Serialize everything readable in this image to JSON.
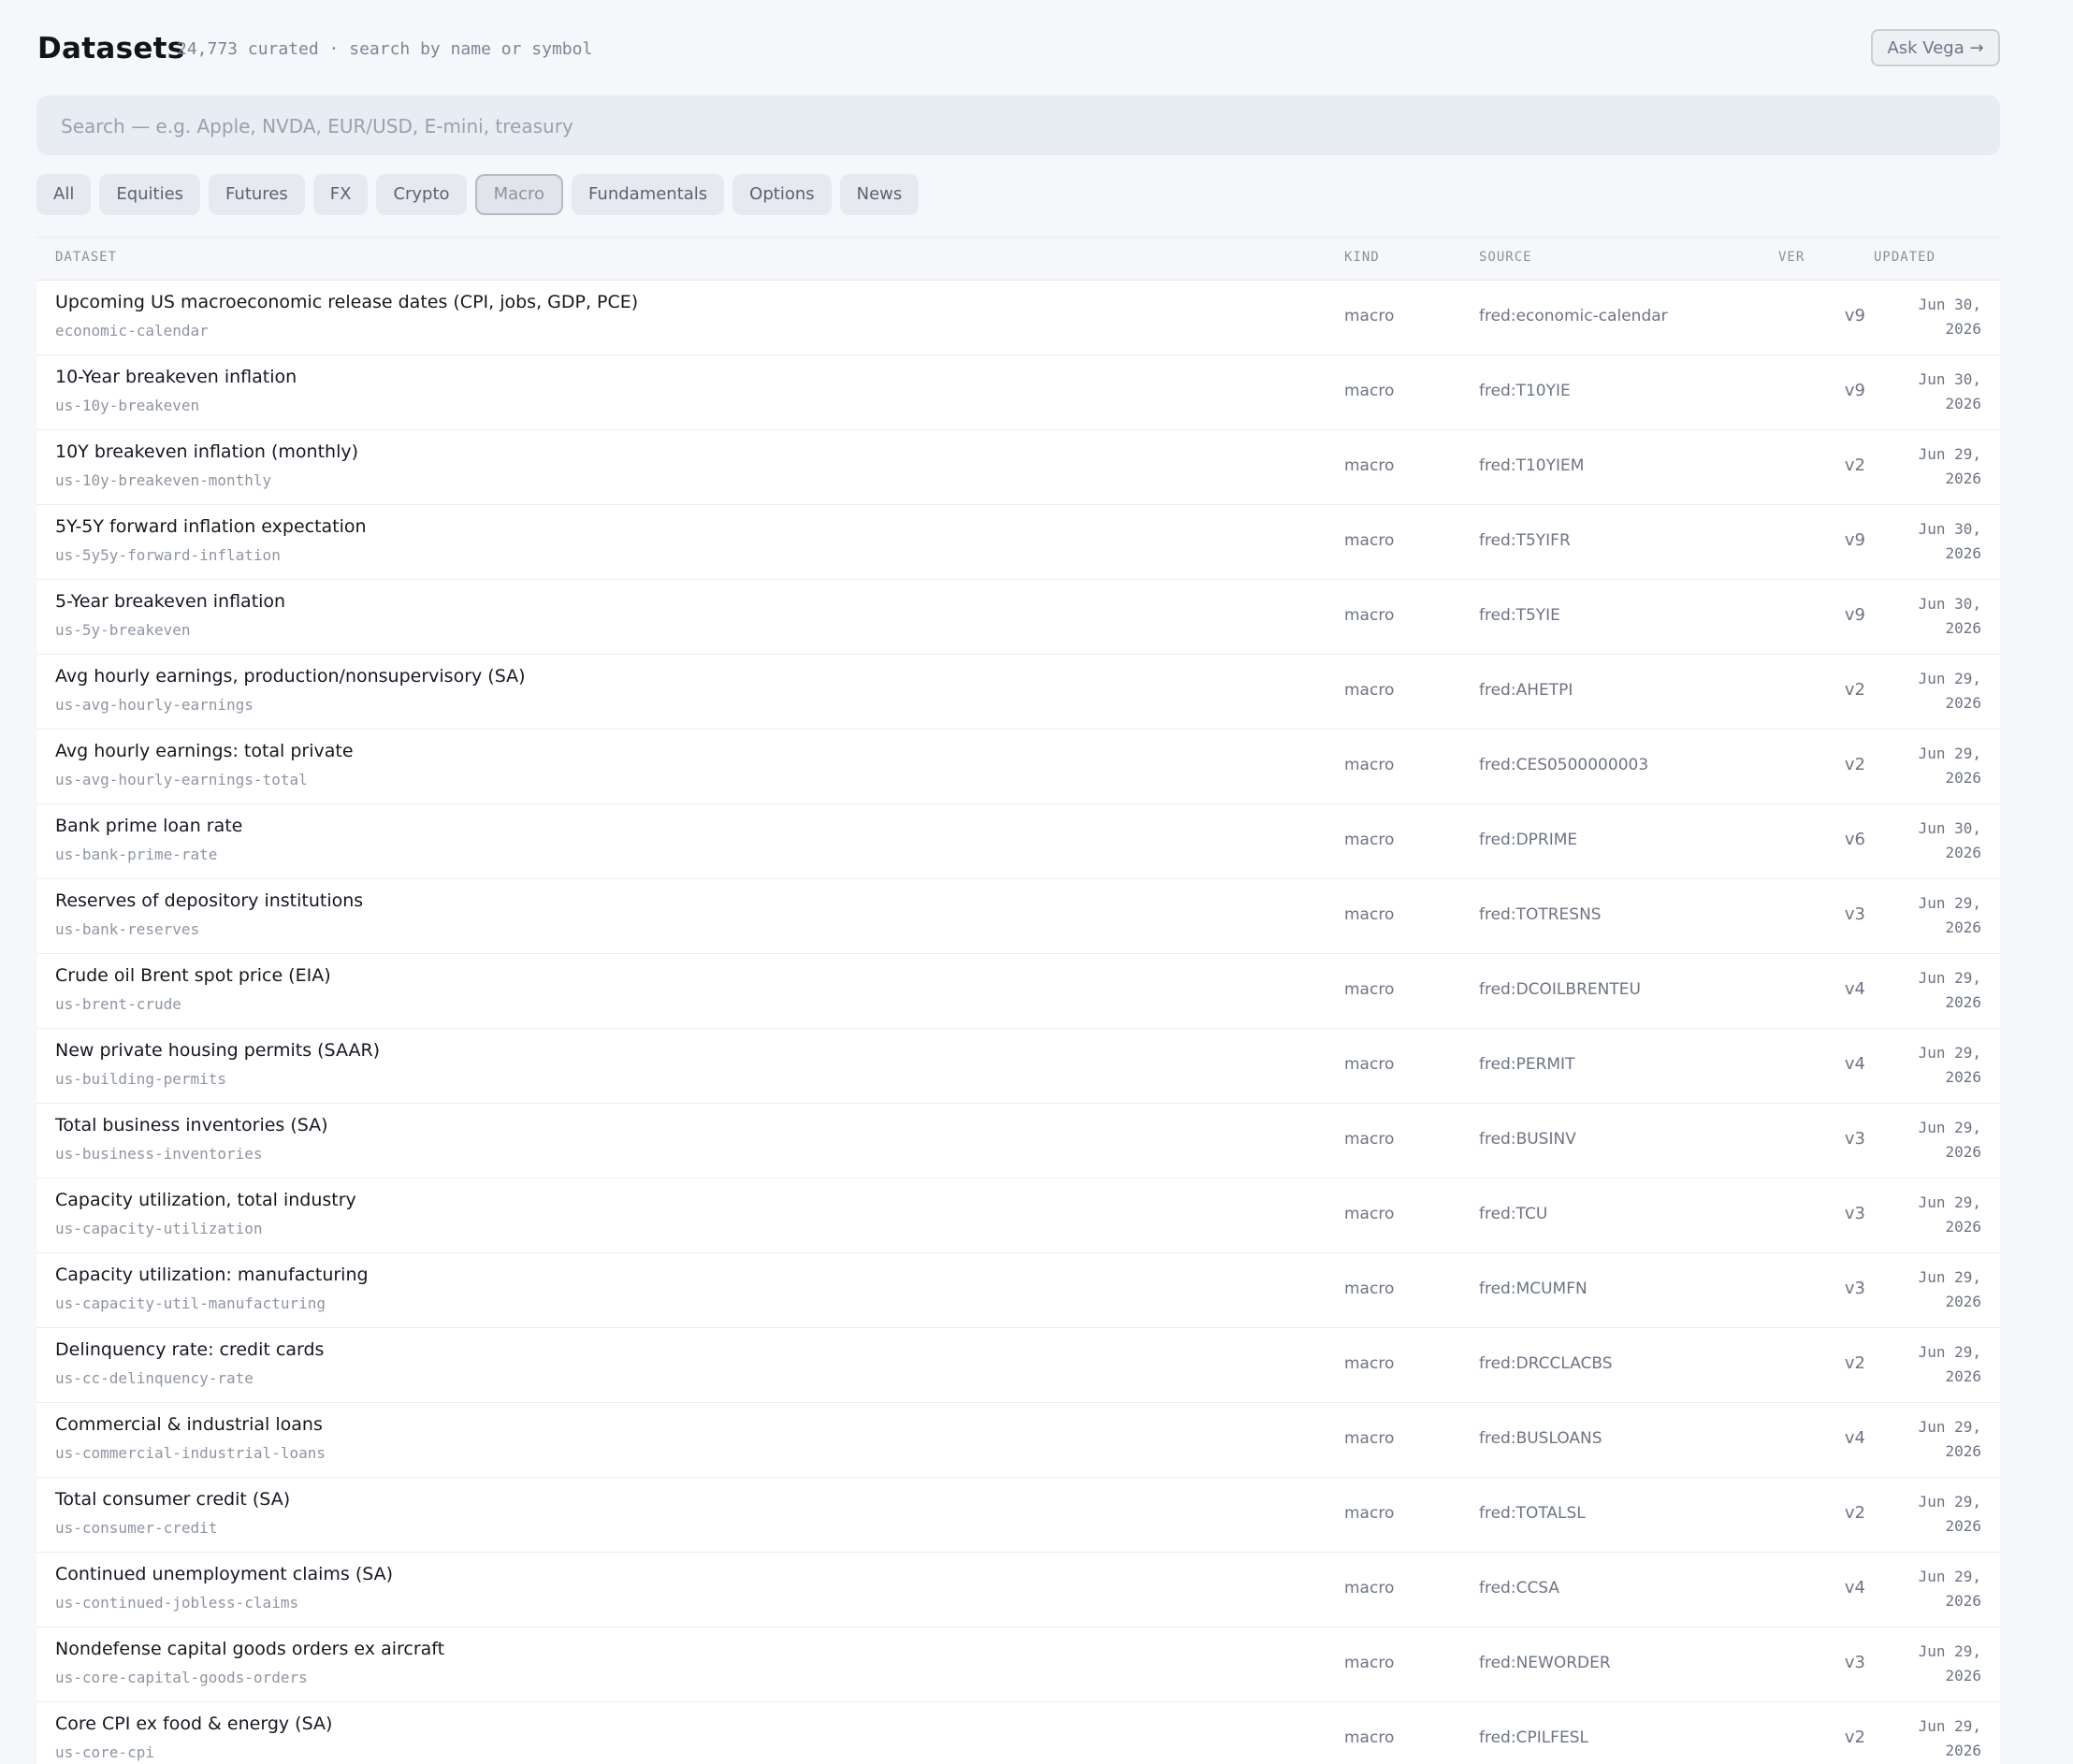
{
  "header": {
    "title": "Datasets",
    "subtitle": "24,773 curated · search by name or symbol",
    "ask_button": "Ask Vega →"
  },
  "search": {
    "placeholder": "Search — e.g. Apple, NVDA, EUR/USD, E-mini, treasury",
    "value": ""
  },
  "filters": [
    {
      "label": "All",
      "active": false
    },
    {
      "label": "Equities",
      "active": false
    },
    {
      "label": "Futures",
      "active": false
    },
    {
      "label": "FX",
      "active": false
    },
    {
      "label": "Crypto",
      "active": false
    },
    {
      "label": "Macro",
      "active": true
    },
    {
      "label": "Fundamentals",
      "active": false
    },
    {
      "label": "Options",
      "active": false
    },
    {
      "label": "News",
      "active": false
    }
  ],
  "table": {
    "columns": {
      "dataset": "DATASET",
      "kind": "KIND",
      "source": "SOURCE",
      "ver": "VER",
      "updated": "UPDATED"
    },
    "rows": [
      {
        "name": "Upcoming US macroeconomic release dates (CPI, jobs, GDP, PCE)",
        "slug": "economic-calendar",
        "kind": "macro",
        "source": "fred:economic-calendar",
        "ver": "v9",
        "updated_date": "Jun 30,",
        "updated_year": "2026"
      },
      {
        "name": "10-Year breakeven inflation",
        "slug": "us-10y-breakeven",
        "kind": "macro",
        "source": "fred:T10YIE",
        "ver": "v9",
        "updated_date": "Jun 30,",
        "updated_year": "2026"
      },
      {
        "name": "10Y breakeven inflation (monthly)",
        "slug": "us-10y-breakeven-monthly",
        "kind": "macro",
        "source": "fred:T10YIEM",
        "ver": "v2",
        "updated_date": "Jun 29,",
        "updated_year": "2026"
      },
      {
        "name": "5Y-5Y forward inflation expectation",
        "slug": "us-5y5y-forward-inflation",
        "kind": "macro",
        "source": "fred:T5YIFR",
        "ver": "v9",
        "updated_date": "Jun 30,",
        "updated_year": "2026"
      },
      {
        "name": "5-Year breakeven inflation",
        "slug": "us-5y-breakeven",
        "kind": "macro",
        "source": "fred:T5YIE",
        "ver": "v9",
        "updated_date": "Jun 30,",
        "updated_year": "2026"
      },
      {
        "name": "Avg hourly earnings, production/nonsupervisory (SA)",
        "slug": "us-avg-hourly-earnings",
        "kind": "macro",
        "source": "fred:AHETPI",
        "ver": "v2",
        "updated_date": "Jun 29,",
        "updated_year": "2026"
      },
      {
        "name": "Avg hourly earnings: total private",
        "slug": "us-avg-hourly-earnings-total",
        "kind": "macro",
        "source": "fred:CES0500000003",
        "ver": "v2",
        "updated_date": "Jun 29,",
        "updated_year": "2026"
      },
      {
        "name": "Bank prime loan rate",
        "slug": "us-bank-prime-rate",
        "kind": "macro",
        "source": "fred:DPRIME",
        "ver": "v6",
        "updated_date": "Jun 30,",
        "updated_year": "2026"
      },
      {
        "name": "Reserves of depository institutions",
        "slug": "us-bank-reserves",
        "kind": "macro",
        "source": "fred:TOTRESNS",
        "ver": "v3",
        "updated_date": "Jun 29,",
        "updated_year": "2026"
      },
      {
        "name": "Crude oil Brent spot price (EIA)",
        "slug": "us-brent-crude",
        "kind": "macro",
        "source": "fred:DCOILBRENTEU",
        "ver": "v4",
        "updated_date": "Jun 29,",
        "updated_year": "2026"
      },
      {
        "name": "New private housing permits (SAAR)",
        "slug": "us-building-permits",
        "kind": "macro",
        "source": "fred:PERMIT",
        "ver": "v4",
        "updated_date": "Jun 29,",
        "updated_year": "2026"
      },
      {
        "name": "Total business inventories (SA)",
        "slug": "us-business-inventories",
        "kind": "macro",
        "source": "fred:BUSINV",
        "ver": "v3",
        "updated_date": "Jun 29,",
        "updated_year": "2026"
      },
      {
        "name": "Capacity utilization, total industry",
        "slug": "us-capacity-utilization",
        "kind": "macro",
        "source": "fred:TCU",
        "ver": "v3",
        "updated_date": "Jun 29,",
        "updated_year": "2026"
      },
      {
        "name": "Capacity utilization: manufacturing",
        "slug": "us-capacity-util-manufacturing",
        "kind": "macro",
        "source": "fred:MCUMFN",
        "ver": "v3",
        "updated_date": "Jun 29,",
        "updated_year": "2026"
      },
      {
        "name": "Delinquency rate: credit cards",
        "slug": "us-cc-delinquency-rate",
        "kind": "macro",
        "source": "fred:DRCCLACBS",
        "ver": "v2",
        "updated_date": "Jun 29,",
        "updated_year": "2026"
      },
      {
        "name": "Commercial & industrial loans",
        "slug": "us-commercial-industrial-loans",
        "kind": "macro",
        "source": "fred:BUSLOANS",
        "ver": "v4",
        "updated_date": "Jun 29,",
        "updated_year": "2026"
      },
      {
        "name": "Total consumer credit (SA)",
        "slug": "us-consumer-credit",
        "kind": "macro",
        "source": "fred:TOTALSL",
        "ver": "v2",
        "updated_date": "Jun 29,",
        "updated_year": "2026"
      },
      {
        "name": "Continued unemployment claims (SA)",
        "slug": "us-continued-jobless-claims",
        "kind": "macro",
        "source": "fred:CCSA",
        "ver": "v4",
        "updated_date": "Jun 29,",
        "updated_year": "2026"
      },
      {
        "name": "Nondefense capital goods orders ex aircraft",
        "slug": "us-core-capital-goods-orders",
        "kind": "macro",
        "source": "fred:NEWORDER",
        "ver": "v3",
        "updated_date": "Jun 29,",
        "updated_year": "2026"
      },
      {
        "name": "Core CPI ex food & energy (SA)",
        "slug": "us-core-cpi",
        "kind": "macro",
        "source": "fred:CPILFESL",
        "ver": "v2",
        "updated_date": "Jun 29,",
        "updated_year": "2026"
      }
    ]
  }
}
